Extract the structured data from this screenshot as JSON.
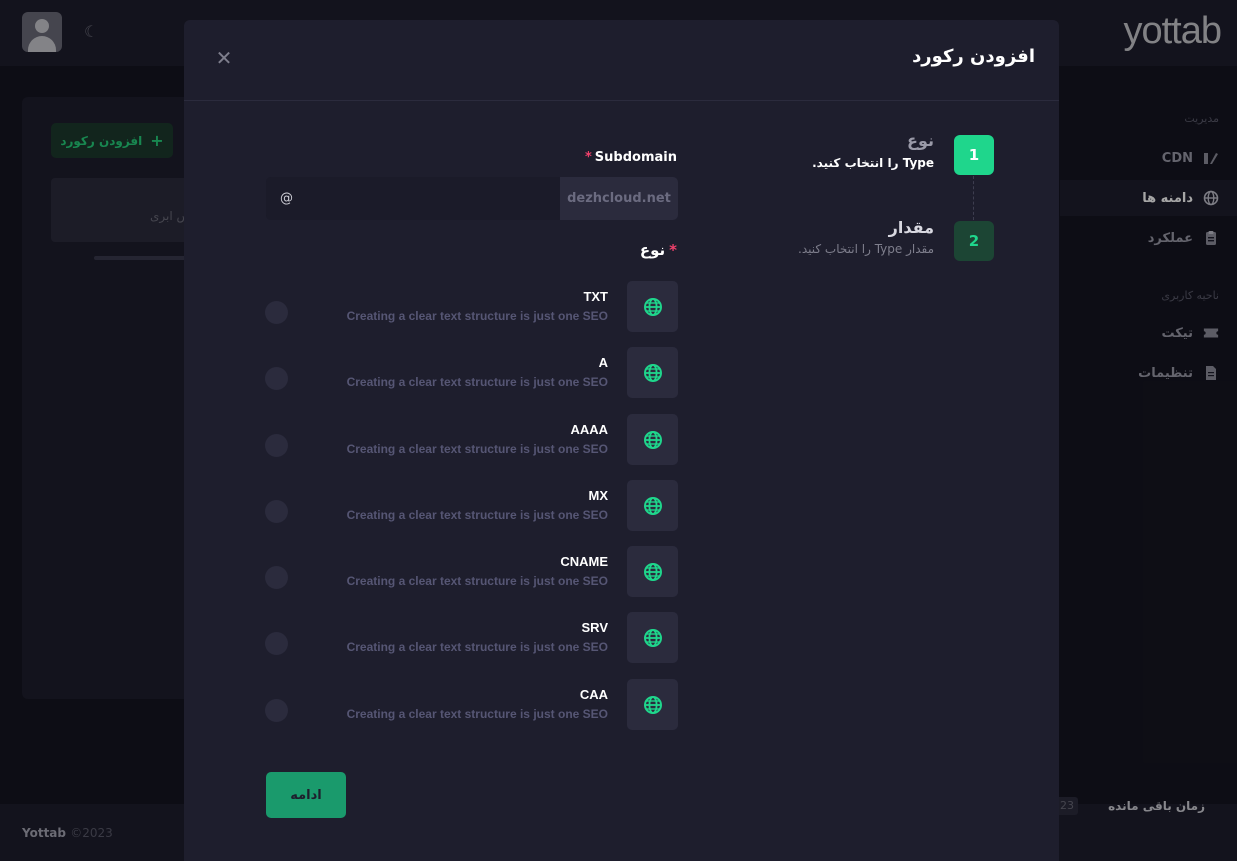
{
  "app": {
    "logo_text": "yottab",
    "theme_icon": "moon-icon"
  },
  "background": {
    "add_record_label": "افزودن رکورد",
    "card_text": "س ابری",
    "sidebar": {
      "section_manage": "مدیریت",
      "items": [
        {
          "label": "CDN",
          "icon": "cdn-icon"
        },
        {
          "label": "دامنه ها",
          "icon": "globe-icon"
        },
        {
          "label": "عملکرد",
          "icon": "clipboard-icon"
        }
      ],
      "section_user": "ناحیه کاربری",
      "user_items": [
        {
          "label": "تیکت",
          "icon": "ticket-icon"
        },
        {
          "label": "تنظیمات",
          "icon": "document-icon"
        }
      ]
    },
    "footer": {
      "brand": "Yottab",
      "year": "©2023",
      "remaining_label": "زمان باقی مانده",
      "badge": "23"
    }
  },
  "modal": {
    "title": "افزودن رکورد",
    "steps": [
      {
        "number": "1",
        "title": "نوع",
        "description": "Type را انتخاب کنید."
      },
      {
        "number": "2",
        "title": "مقدار",
        "description": "مقدار Type را انتخاب کنید."
      }
    ],
    "subdomain": {
      "label": "Subdomain",
      "required_mark": "*",
      "value": "@",
      "suffix": "dezhcloud.net"
    },
    "type": {
      "label": "نوع",
      "required_mark": "*",
      "options": [
        {
          "name": "TXT",
          "description": "Creating a clear text structure is just one SEO",
          "icon": "globe-icon"
        },
        {
          "name": "A",
          "description": "Creating a clear text structure is just one SEO",
          "icon": "globe-icon"
        },
        {
          "name": "AAAA",
          "description": "Creating a clear text structure is just one SEO",
          "icon": "globe-icon"
        },
        {
          "name": "MX",
          "description": "Creating a clear text structure is just one SEO",
          "icon": "globe-icon"
        },
        {
          "name": "CNAME",
          "description": "Creating a clear text structure is just one SEO",
          "icon": "globe-icon"
        },
        {
          "name": "SRV",
          "description": "Creating a clear text structure is just one SEO",
          "icon": "globe-icon"
        },
        {
          "name": "CAA",
          "description": "Creating a clear text structure is just one SEO",
          "icon": "globe-icon"
        }
      ]
    },
    "continue_label": "ادامه",
    "colors": {
      "accent": "#1fd68c",
      "required": "#f1416c"
    }
  }
}
